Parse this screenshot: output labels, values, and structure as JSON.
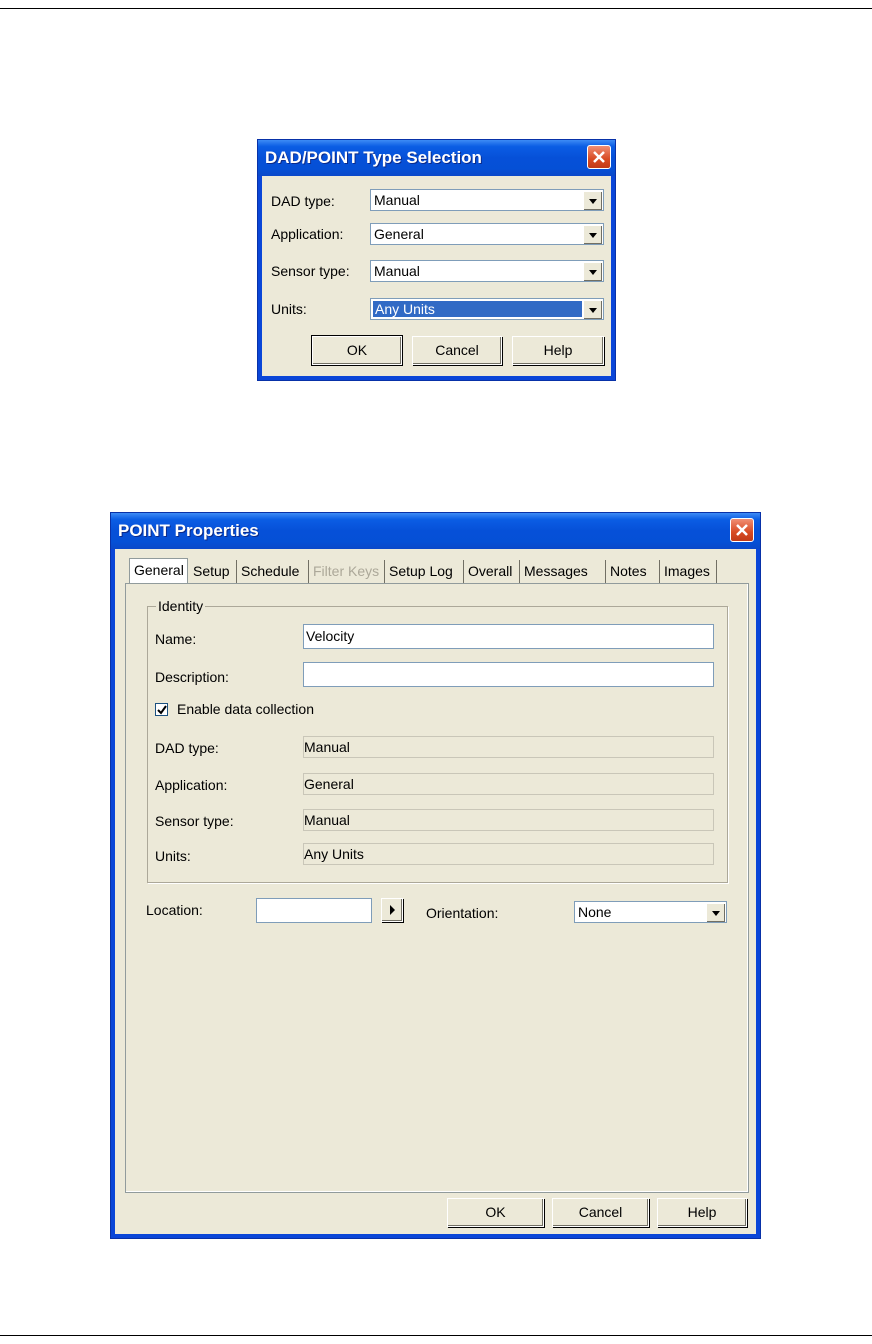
{
  "dialog1": {
    "title": "DAD/POINT Type Selection",
    "fields": [
      {
        "label": "DAD type:",
        "value": "Manual"
      },
      {
        "label": "Application:",
        "value": "General"
      },
      {
        "label": "Sensor type:",
        "value": "Manual"
      },
      {
        "label": "Units:",
        "value": "Any Units"
      }
    ],
    "buttons": {
      "ok": "OK",
      "cancel": "Cancel",
      "help": "Help"
    }
  },
  "dialog2": {
    "title": "POINT Properties",
    "tabs": [
      "General",
      "Setup",
      "Schedule",
      "Filter Keys",
      "Setup Log",
      "Overall",
      "Messages",
      "Notes",
      "Images"
    ],
    "active_tab": "General",
    "disabled_tabs": [
      "Filter Keys"
    ],
    "identity": {
      "legend": "Identity",
      "name_label": "Name:",
      "name_value": "Velocity",
      "description_label": "Description:",
      "description_value": "",
      "enable_label": "Enable data collection",
      "enable_checked": true,
      "dad_type_label": "DAD type:",
      "dad_type_value": "Manual",
      "application_label": "Application:",
      "application_value": "General",
      "sensor_label": "Sensor type:",
      "sensor_value": "Manual",
      "units_label": "Units:",
      "units_value": "Any Units"
    },
    "location_label": "Location:",
    "location_value": "",
    "orientation_label": "Orientation:",
    "orientation_value": "None",
    "buttons": {
      "ok": "OK",
      "cancel": "Cancel",
      "help": "Help"
    }
  }
}
